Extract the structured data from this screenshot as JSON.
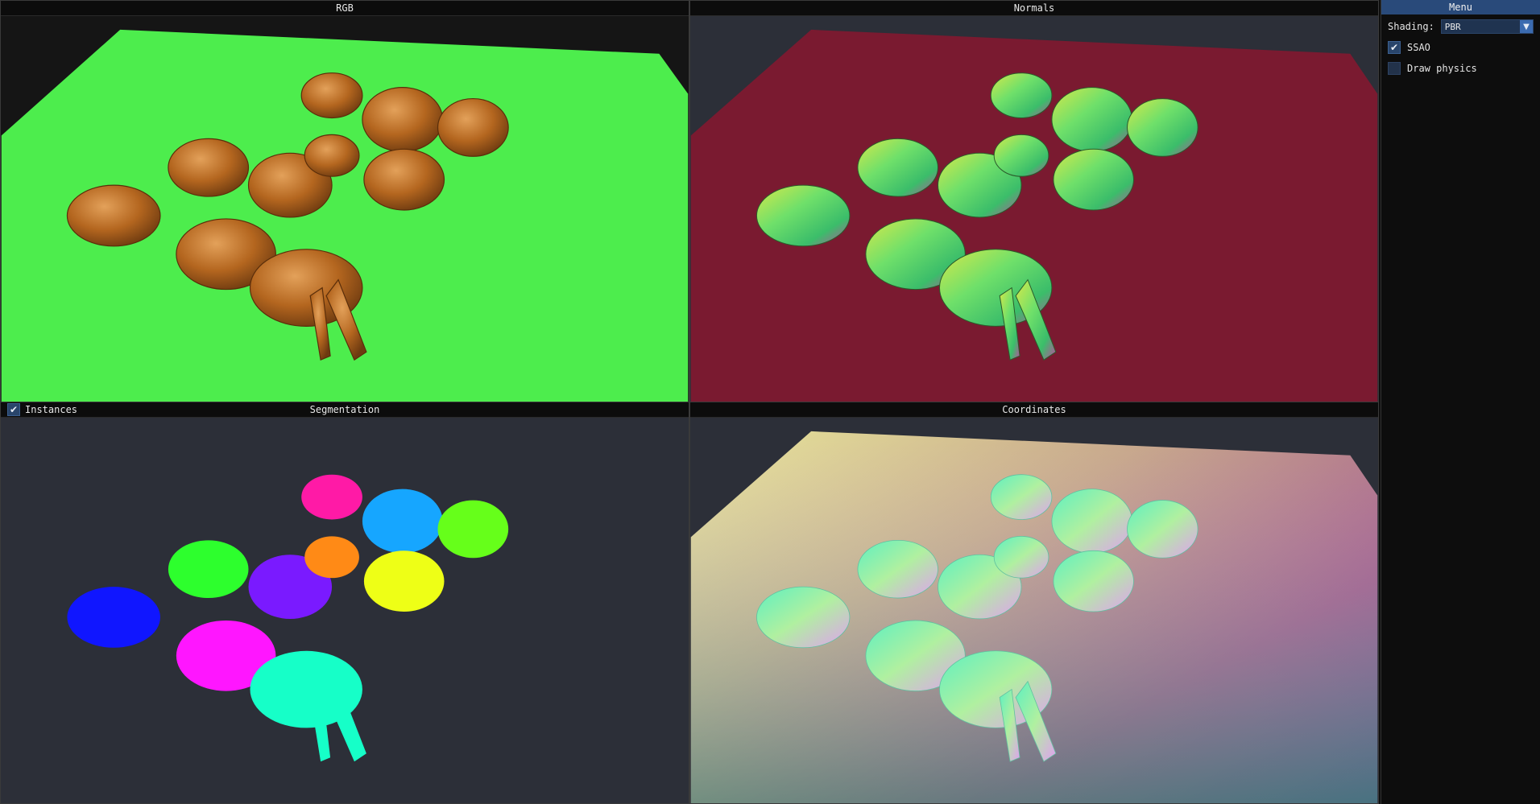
{
  "panes": {
    "rgb": {
      "title": "RGB"
    },
    "normals": {
      "title": "Normals"
    },
    "segmentation": {
      "title": "Segmentation",
      "instances_label": "Instances",
      "instances_checked": true
    },
    "coordinates": {
      "title": "Coordinates"
    }
  },
  "menu": {
    "title": "Menu",
    "shading_label": "Shading:",
    "shading_value": "PBR",
    "ssao_label": "SSAO",
    "ssao_checked": true,
    "physics_label": "Draw physics",
    "physics_checked": false
  },
  "colors": {
    "rgb_ground": "#4ded4d",
    "normals_ground": "#7a1a30",
    "viewport_bg": "#2c2f38",
    "bunny_rgb": "#b56a25",
    "menu_accent": "#294a7a"
  }
}
